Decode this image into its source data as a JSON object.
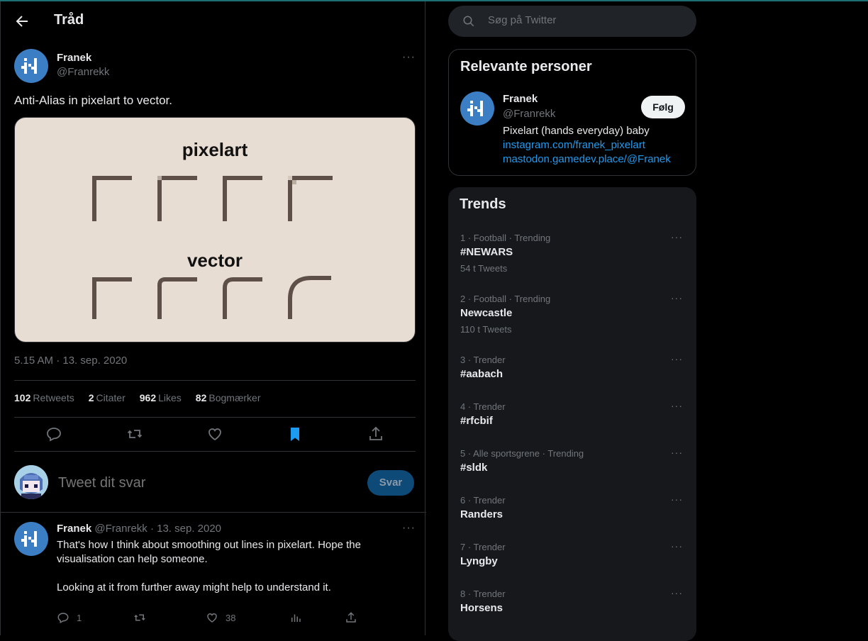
{
  "header": {
    "title": "Tråd"
  },
  "tweet": {
    "name": "Franek",
    "handle": "@Franrekk",
    "more": "···",
    "text": "Anti-Alias in pixelart to vector.",
    "media": {
      "label_top": "pixelart",
      "label_bottom": "vector"
    },
    "timestamp": "5.15 AM · 13. sep. 2020",
    "stats": [
      {
        "count": "102",
        "label": "Retweets"
      },
      {
        "count": "2",
        "label": "Citater"
      },
      {
        "count": "962",
        "label": "Likes"
      },
      {
        "count": "82",
        "label": "Bogmærker"
      }
    ]
  },
  "reply_box": {
    "placeholder": "Tweet dit svar",
    "button": "Svar"
  },
  "reply": {
    "name": "Franek",
    "handle": "@Franrekk · 13. sep. 2020",
    "line1": "That's how I think about smoothing out lines in pixelart. Hope the visualisation can help someone.",
    "line2": "Looking at it from further away might help to understand it.",
    "replies": "1",
    "likes": "38"
  },
  "search": {
    "placeholder": "Søg på Twitter"
  },
  "people": {
    "title": "Relevante personer",
    "name": "Franek",
    "handle": "@Franrekk",
    "follow": "Følg",
    "bio": "Pixelart (hands everyday) baby",
    "link1": "instagram.com/franek_pixelart",
    "link2": "mastodon.gamedev.place/@Franek"
  },
  "trends": {
    "title": "Trends",
    "items": [
      {
        "meta": "1 · Football · Trending",
        "name": "#NEWARS",
        "count": "54 t Tweets"
      },
      {
        "meta": "2 · Football · Trending",
        "name": "Newcastle",
        "count": "110 t Tweets"
      },
      {
        "meta": "3 · Trender",
        "name": "#aabach",
        "count": ""
      },
      {
        "meta": "4 · Trender",
        "name": "#rfcbif",
        "count": ""
      },
      {
        "meta": "5 · Alle sportsgrene · Trending",
        "name": "#sldk",
        "count": ""
      },
      {
        "meta": "6 · Trender",
        "name": "Randers",
        "count": ""
      },
      {
        "meta": "7 · Trender",
        "name": "Lyngby",
        "count": ""
      },
      {
        "meta": "8 · Trender",
        "name": "Horsens",
        "count": ""
      }
    ]
  },
  "colors": {
    "accent": "#1d9bf0",
    "background": "#000000",
    "card": "#16181c",
    "muted": "#71767b"
  }
}
